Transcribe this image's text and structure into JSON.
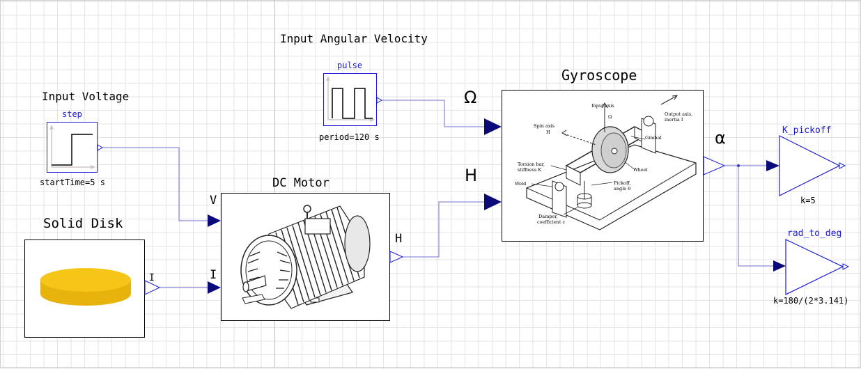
{
  "labels": {
    "input_voltage": "Input Voltage",
    "input_angular_velocity": "Input Angular Velocity",
    "dc_motor": "DC Motor",
    "solid_disk": "Solid Disk",
    "gyroscope": "Gyroscope"
  },
  "blocks": {
    "step": {
      "name": "step",
      "param": "startTime=5 s"
    },
    "pulse": {
      "name": "pulse",
      "param": "period=120 s"
    },
    "k_pickoff": {
      "name": "K_pickoff",
      "param": "k=5"
    },
    "rad_to_deg": {
      "name": "rad_to_deg",
      "param": "k=180/(2*3.141)"
    }
  },
  "ports": {
    "motor_v": "V",
    "motor_i": "I",
    "motor_h": "H",
    "disk_i": "I",
    "gyro_omega": "Ω",
    "gyro_h": "H",
    "gyro_alpha": "α"
  },
  "gyroscope_figure_labels": {
    "input_axis": "Input axis",
    "omega": "Ω",
    "output_axis": "Output axis,",
    "inertia": "inertia I",
    "spin_axis": "Spin axis",
    "spin_h": "H",
    "gimbal": "Gimbal",
    "torsion_bar": "Torsion bar,",
    "stiffness": "stiffness K",
    "wheel": "Wheel",
    "weld": "Weld",
    "pickoff": "Pickoff,",
    "angle": "angle θ",
    "damper": "Damper,",
    "coefficient": "coefficient c"
  },
  "colors": {
    "block_blue": "#1a1ad6",
    "port_navy": "#0a0a78",
    "wire": "#6c6cd0",
    "disk_yellow": "#f2c014"
  }
}
